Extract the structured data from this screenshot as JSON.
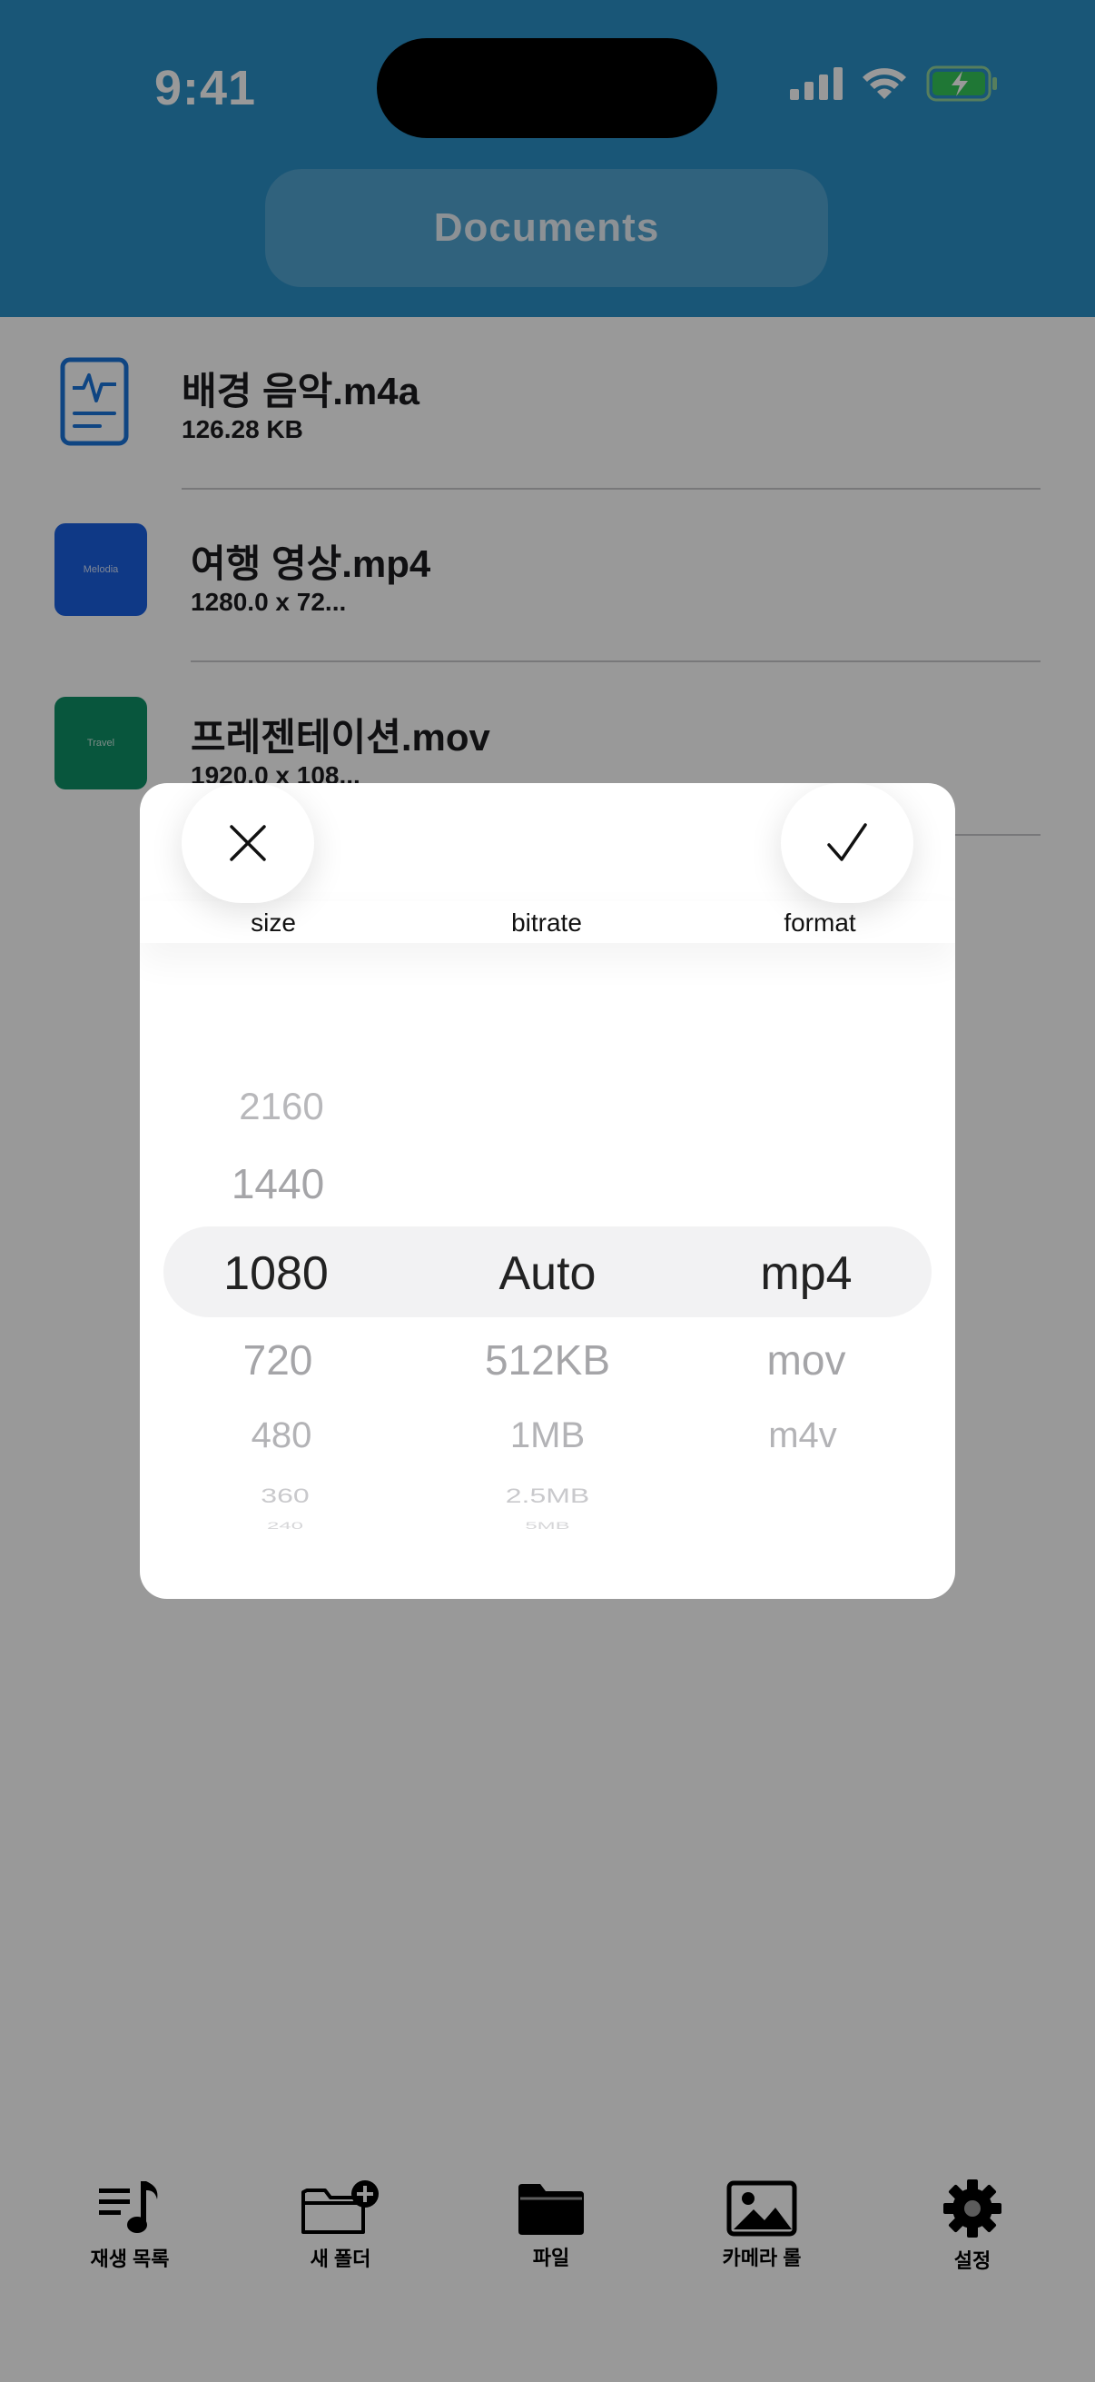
{
  "status_bar": {
    "time": "9:41"
  },
  "header": {
    "title": "Documents"
  },
  "files": [
    {
      "name": "배경 음악.m4a",
      "meta": "126.28 KB",
      "thumb_type": "audio-file-icon"
    },
    {
      "name": "여행 영상.mp4",
      "meta": "1280.0 x 72...",
      "thumb_type": "video-thumbnail",
      "thumb_text": "Melodia",
      "thumb_color": "#1a5fe0"
    },
    {
      "name": "프레젠테이션.mov",
      "meta": "1920.0 x 108...",
      "thumb_type": "video-thumbnail",
      "thumb_text": "Travel",
      "thumb_color": "#0e8f67"
    }
  ],
  "picker": {
    "columns": [
      {
        "header": "size",
        "selected": "1080",
        "above": [
          "1440",
          "2160"
        ],
        "below": [
          "720",
          "480",
          "360",
          "240"
        ]
      },
      {
        "header": "bitrate",
        "selected": "Auto",
        "above": [],
        "below": [
          "512KB",
          "1MB",
          "2.5MB",
          "5MB"
        ]
      },
      {
        "header": "format",
        "selected": "mp4",
        "above": [],
        "below": [
          "mov",
          "m4v"
        ]
      }
    ],
    "cancel_icon": "close-icon",
    "confirm_icon": "checkmark-icon"
  },
  "tabbar": {
    "items": [
      {
        "label": "재생 목록",
        "icon": "playlist-icon"
      },
      {
        "label": "새 폴더",
        "icon": "new-folder-icon"
      },
      {
        "label": "파일",
        "icon": "folder-icon"
      },
      {
        "label": "카메라 롤",
        "icon": "photo-icon"
      },
      {
        "label": "설정",
        "icon": "gear-icon"
      }
    ]
  },
  "colors": {
    "header": "#2a8fc7",
    "accent_blue": "#1a73d9",
    "battery_green": "#34c759"
  }
}
